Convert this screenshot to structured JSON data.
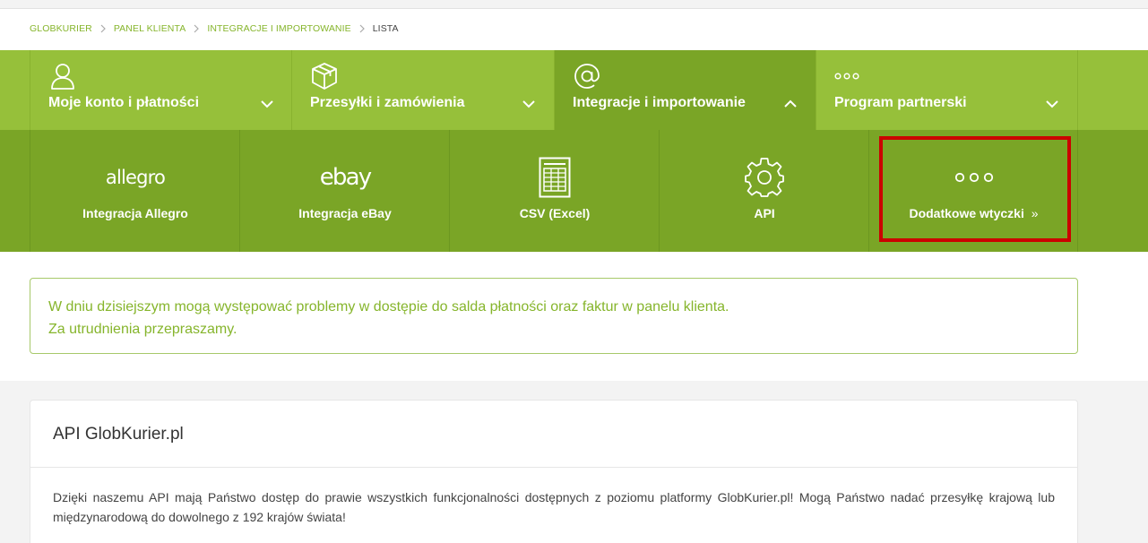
{
  "breadcrumb": {
    "items": [
      "GLOBKURIER",
      "PANEL KLIENTA",
      "INTEGRACJE I IMPORTOWANIE"
    ],
    "current": "LISTA"
  },
  "main_nav": {
    "items": [
      {
        "label": "Moje konto i płatności",
        "icon": "user-icon",
        "expanded": false
      },
      {
        "label": "Przesyłki i zamówienia",
        "icon": "package-icon",
        "expanded": false
      },
      {
        "label": "Integracje i importowanie",
        "icon": "at-sign-icon",
        "expanded": true
      },
      {
        "label": "Program partnerski",
        "icon": "more-dots-icon",
        "expanded": false
      }
    ]
  },
  "sub_nav": {
    "items": [
      {
        "brand": "allegro",
        "label": "Integracja Allegro"
      },
      {
        "brand": "ebay",
        "label": "Integracja eBay"
      },
      {
        "label": "CSV (Excel)",
        "icon": "spreadsheet-icon"
      },
      {
        "label": "API",
        "icon": "gear-icon"
      },
      {
        "label": "Dodatkowe wtyczki",
        "icon": "more-dots-icon",
        "suffix": "»"
      }
    ]
  },
  "notice": {
    "line1": "W dniu dzisiejszym mogą występować problemy w dostępie do salda płatności oraz faktur w panelu klienta.",
    "line2": "Za utrudnienia przepraszamy."
  },
  "api_card": {
    "title": "API GlobKurier.pl",
    "body": "Dzięki naszemu API mają Państwo dostęp do prawie wszystkich funkcjonalności dostępnych z poziomu platformy GlobKurier.pl! Mogą Państwo nadać przesyłkę krajową lub międzynarodową do dowolnego z 192 krajów świata!"
  },
  "colors": {
    "nav_green": "#96c03a",
    "nav_active_green": "#7aa526",
    "link_green": "#86b52c",
    "highlight_red": "#cc0000"
  }
}
